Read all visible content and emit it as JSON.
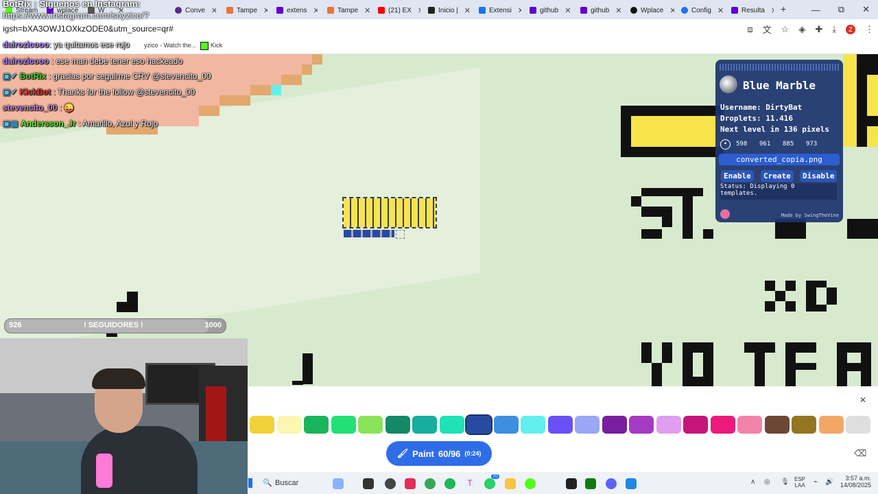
{
  "tabs": [
    {
      "label": "BotRix",
      "color": "#2b9d3a"
    },
    {
      "label": "Stream",
      "color": "#53fc18"
    },
    {
      "label": "wplace",
      "color": "#6001d2"
    },
    {
      "label": "W",
      "color": "#555555"
    },
    {
      "label": "Conve",
      "color": "#5b2a86"
    },
    {
      "label": "Tampe",
      "color": "#e8743b"
    },
    {
      "label": "extens",
      "color": "#6001d2"
    },
    {
      "label": "Tampe",
      "color": "#e8743b"
    },
    {
      "label": "(21) EX",
      "color": "#ff0000"
    },
    {
      "label": "Inicio |",
      "color": "#222222"
    },
    {
      "label": "Extensi",
      "color": "#1a73e8"
    },
    {
      "label": "github",
      "color": "#6001d2"
    },
    {
      "label": "github",
      "color": "#6001d2"
    },
    {
      "label": "Wplace",
      "color": "#111111"
    },
    {
      "label": "Config",
      "color": "#1a73e8"
    },
    {
      "label": "Resulta",
      "color": "#6001d2"
    }
  ],
  "window": {
    "minimize": "—",
    "maximize": "⧉",
    "close": "✕",
    "new_tab": "+"
  },
  "address": {
    "url": "igsh=bXA3OWJ1OXkzODE0&utm_source=qr#",
    "overlay_line1": "BotRix : Síguenos en Instagram:",
    "overlay_line2": "https://www.instagram.com/soyzico/?",
    "avatar_letter": "Z"
  },
  "bookmarks": {
    "item1": "yzico - Watch the...",
    "item2": "Kick"
  },
  "chat": [
    {
      "user": "dairozicooo",
      "text": ": ya quitamos ese rojo",
      "user_color": "#b38cff"
    },
    {
      "user": "dairozicooo",
      "text": ": ese man debe tener eso hackeado",
      "user_color": "#b38cff"
    },
    {
      "user": "BotRix",
      "text": ": gracias por seguirme CRV @stevencito_00",
      "user_color": "#4cd137"
    },
    {
      "user": "KickBot",
      "text": ": Thanks for the follow @stevencito_00",
      "user_color": "#e53935"
    },
    {
      "user": "stevencito_00",
      "text": ": 😜",
      "user_color": "#c48bd6"
    },
    {
      "user": "Andersson_Jr",
      "text": ": Amarillo, Azul y Rojo",
      "user_color": "#53fc18"
    }
  ],
  "blue_marble": {
    "title": "Blue Marble",
    "username_label": "Username:",
    "username": "DirtyBat",
    "droplets_label": "Droplets:",
    "droplets": "11.416",
    "next_level_prefix": "Next level in",
    "next_level_value": "136",
    "next_level_suffix": "pixels",
    "coords": [
      "598",
      "961",
      "885",
      "973"
    ],
    "file": "converted_copia.png",
    "enable": "Enable",
    "create": "Create",
    "disable": "Disable",
    "status": "Status: Displaying 0",
    "status2": "templates.",
    "credit": "Made by SwingTheVine"
  },
  "follow_goal": {
    "current": "926",
    "label": "! SEGUIDORES !",
    "target": "1000",
    "progress": 0.926
  },
  "palette": [
    "#f2d13a",
    "#fbf6b0",
    "#19b55a",
    "#21e176",
    "#89e45b",
    "#128a64",
    "#16ae9e",
    "#1fe2b7",
    "#284aa1",
    "#3f8fe0",
    "#62f0ee",
    "#6b50f5",
    "#99a7f5",
    "#781e9e",
    "#a63bc2",
    "#e19df0",
    "#c4157a",
    "#ec1a7c",
    "#f283a8",
    "#6b4736",
    "#947620",
    "#f2a766",
    "#dedede"
  ],
  "paint": {
    "label": "Paint",
    "count": "60/96",
    "timer": "(0:24)"
  },
  "taskbar": {
    "search": "Buscar",
    "lang": "ESP",
    "lang2": "LAA",
    "time": "3:57 a.m.",
    "date": "14/08/2025",
    "badge": "70"
  }
}
